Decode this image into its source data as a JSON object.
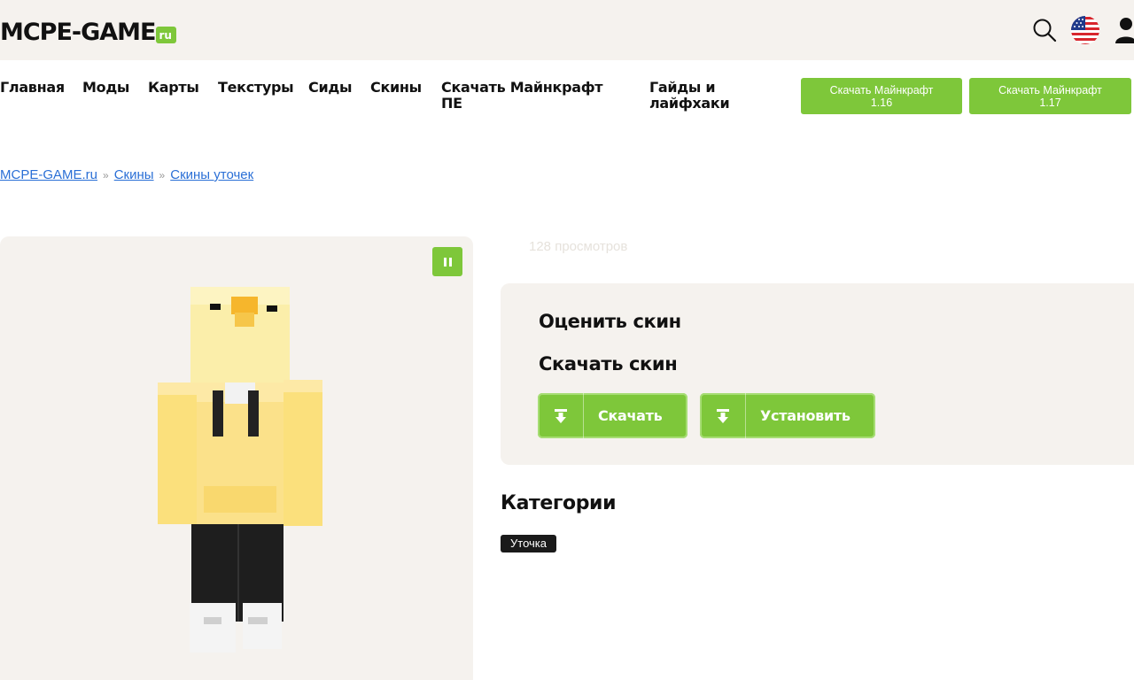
{
  "header": {
    "logo_text": "MCPE-GAME",
    "logo_tld": "ru",
    "icons": [
      "search-icon",
      "flag-us-icon",
      "user-icon"
    ]
  },
  "nav": {
    "items": [
      {
        "label": "Главная"
      },
      {
        "label": "Моды"
      },
      {
        "label": "Карты"
      },
      {
        "label": "Текстуры"
      },
      {
        "label": "Сиды"
      },
      {
        "label": "Скины"
      },
      {
        "label": "Скачать Майнкрафт ПЕ"
      },
      {
        "label": "Гайды и лайфхаки"
      }
    ],
    "download_buttons": [
      {
        "label": "Скачать Майнкрафт",
        "version": "1.16"
      },
      {
        "label": "Скачать Майнкрафт",
        "version": "1.17"
      }
    ]
  },
  "breadcrumb": {
    "items": [
      "MCPE-GAME.ru",
      "Скины",
      "Скины уточек"
    ],
    "separator": "»"
  },
  "preview": {
    "pause_icon": "pause-icon"
  },
  "stats": {
    "views": "128 просмотров"
  },
  "panel": {
    "rate_title": "Оценить скин",
    "download_title": "Скачать скин",
    "download_label": "Скачать",
    "install_label": "Установить"
  },
  "categories": {
    "title": "Категории",
    "tags": [
      "Уточка"
    ]
  },
  "colors": {
    "accent_green": "#7ec73a",
    "panel_bg": "#f5f2ee",
    "link_blue": "#2a6fd6",
    "tag_bg": "#1a1a1a"
  }
}
